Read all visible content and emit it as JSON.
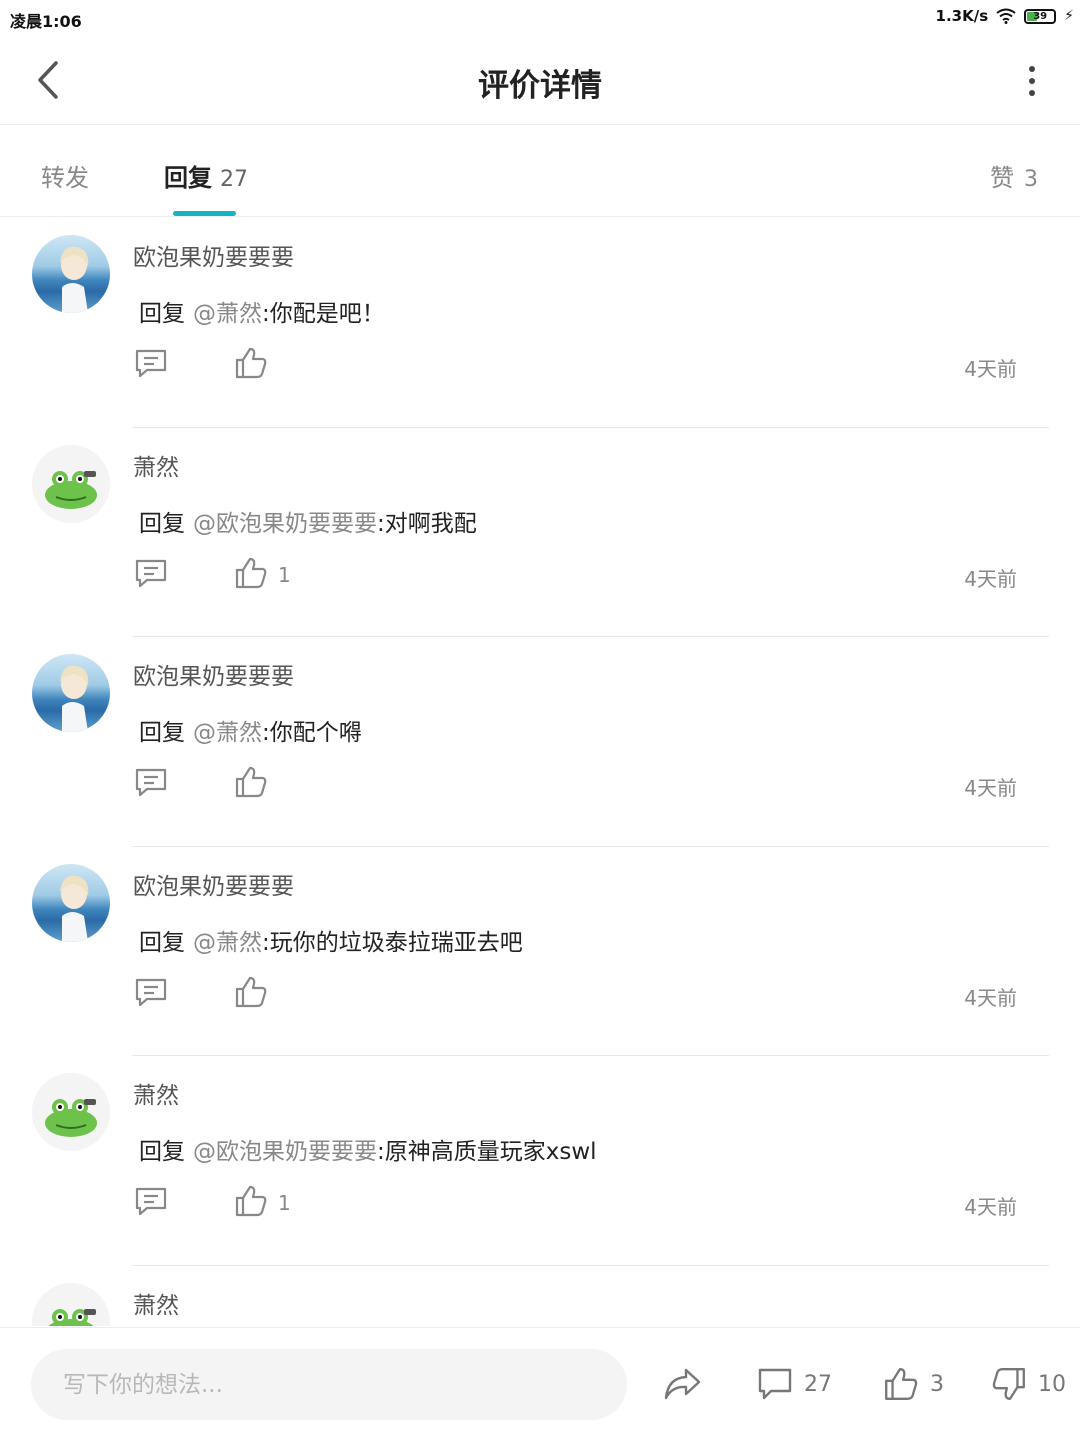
{
  "status_bar": {
    "time": "凌晨1:06",
    "net_speed": "1.3K/s",
    "battery": "39"
  },
  "header": {
    "title": "评价详情"
  },
  "tabs": {
    "forward": {
      "label": "转发"
    },
    "reply": {
      "label": "回复",
      "count": "27"
    },
    "like": {
      "label": "赞",
      "count": "3"
    }
  },
  "replies": [
    {
      "name": "欧泡果奶要要要",
      "prefix": "回复",
      "mention": "@萧然",
      "text": ":你配是吧！",
      "likes": "",
      "time": "4天前",
      "avatar": "sky"
    },
    {
      "name": "萧然",
      "prefix": "回复",
      "mention": "@欧泡果奶要要要",
      "text": ":对啊我配",
      "likes": "1",
      "time": "4天前",
      "avatar": "frog"
    },
    {
      "name": "欧泡果奶要要要",
      "prefix": "回复",
      "mention": "@萧然",
      "text": ":你配个嘚",
      "likes": "",
      "time": "4天前",
      "avatar": "sky"
    },
    {
      "name": "欧泡果奶要要要",
      "prefix": "回复",
      "mention": "@萧然",
      "text": ":玩你的垃圾泰拉瑞亚去吧",
      "likes": "",
      "time": "4天前",
      "avatar": "sky"
    },
    {
      "name": "萧然",
      "prefix": "回复",
      "mention": "@欧泡果奶要要要",
      "text": ":原神高质量玩家xswl",
      "likes": "1",
      "time": "4天前",
      "avatar": "frog"
    },
    {
      "name": "萧然",
      "prefix": "",
      "mention": "",
      "text": "",
      "likes": "",
      "time": "",
      "avatar": "frog"
    }
  ],
  "bottom_bar": {
    "input_placeholder": "写下你的想法...",
    "comment_count": "27",
    "like_count": "3",
    "dislike_count": "10"
  },
  "colors": {
    "accent": "#14b4c2",
    "mention": "#888888",
    "divider": "#e8e8e8"
  },
  "icons": [
    "back-arrow-icon",
    "more-vertical-icon",
    "comment-icon",
    "thumbs-up-icon",
    "share-icon",
    "thumbs-down-icon",
    "wifi-icon",
    "battery-icon"
  ]
}
